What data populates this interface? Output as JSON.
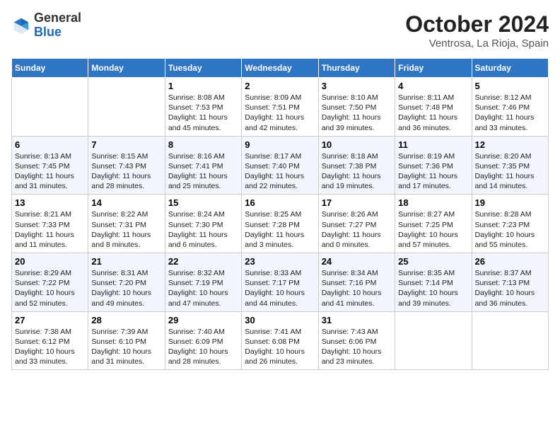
{
  "header": {
    "logo_general": "General",
    "logo_blue": "Blue",
    "month_title": "October 2024",
    "location": "Ventrosa, La Rioja, Spain"
  },
  "weekdays": [
    "Sunday",
    "Monday",
    "Tuesday",
    "Wednesday",
    "Thursday",
    "Friday",
    "Saturday"
  ],
  "weeks": [
    [
      {
        "day": "",
        "content": ""
      },
      {
        "day": "",
        "content": ""
      },
      {
        "day": "1",
        "content": "Sunrise: 8:08 AM\nSunset: 7:53 PM\nDaylight: 11 hours and 45 minutes."
      },
      {
        "day": "2",
        "content": "Sunrise: 8:09 AM\nSunset: 7:51 PM\nDaylight: 11 hours and 42 minutes."
      },
      {
        "day": "3",
        "content": "Sunrise: 8:10 AM\nSunset: 7:50 PM\nDaylight: 11 hours and 39 minutes."
      },
      {
        "day": "4",
        "content": "Sunrise: 8:11 AM\nSunset: 7:48 PM\nDaylight: 11 hours and 36 minutes."
      },
      {
        "day": "5",
        "content": "Sunrise: 8:12 AM\nSunset: 7:46 PM\nDaylight: 11 hours and 33 minutes."
      }
    ],
    [
      {
        "day": "6",
        "content": "Sunrise: 8:13 AM\nSunset: 7:45 PM\nDaylight: 11 hours and 31 minutes."
      },
      {
        "day": "7",
        "content": "Sunrise: 8:15 AM\nSunset: 7:43 PM\nDaylight: 11 hours and 28 minutes."
      },
      {
        "day": "8",
        "content": "Sunrise: 8:16 AM\nSunset: 7:41 PM\nDaylight: 11 hours and 25 minutes."
      },
      {
        "day": "9",
        "content": "Sunrise: 8:17 AM\nSunset: 7:40 PM\nDaylight: 11 hours and 22 minutes."
      },
      {
        "day": "10",
        "content": "Sunrise: 8:18 AM\nSunset: 7:38 PM\nDaylight: 11 hours and 19 minutes."
      },
      {
        "day": "11",
        "content": "Sunrise: 8:19 AM\nSunset: 7:36 PM\nDaylight: 11 hours and 17 minutes."
      },
      {
        "day": "12",
        "content": "Sunrise: 8:20 AM\nSunset: 7:35 PM\nDaylight: 11 hours and 14 minutes."
      }
    ],
    [
      {
        "day": "13",
        "content": "Sunrise: 8:21 AM\nSunset: 7:33 PM\nDaylight: 11 hours and 11 minutes."
      },
      {
        "day": "14",
        "content": "Sunrise: 8:22 AM\nSunset: 7:31 PM\nDaylight: 11 hours and 8 minutes."
      },
      {
        "day": "15",
        "content": "Sunrise: 8:24 AM\nSunset: 7:30 PM\nDaylight: 11 hours and 6 minutes."
      },
      {
        "day": "16",
        "content": "Sunrise: 8:25 AM\nSunset: 7:28 PM\nDaylight: 11 hours and 3 minutes."
      },
      {
        "day": "17",
        "content": "Sunrise: 8:26 AM\nSunset: 7:27 PM\nDaylight: 11 hours and 0 minutes."
      },
      {
        "day": "18",
        "content": "Sunrise: 8:27 AM\nSunset: 7:25 PM\nDaylight: 10 hours and 57 minutes."
      },
      {
        "day": "19",
        "content": "Sunrise: 8:28 AM\nSunset: 7:23 PM\nDaylight: 10 hours and 55 minutes."
      }
    ],
    [
      {
        "day": "20",
        "content": "Sunrise: 8:29 AM\nSunset: 7:22 PM\nDaylight: 10 hours and 52 minutes."
      },
      {
        "day": "21",
        "content": "Sunrise: 8:31 AM\nSunset: 7:20 PM\nDaylight: 10 hours and 49 minutes."
      },
      {
        "day": "22",
        "content": "Sunrise: 8:32 AM\nSunset: 7:19 PM\nDaylight: 10 hours and 47 minutes."
      },
      {
        "day": "23",
        "content": "Sunrise: 8:33 AM\nSunset: 7:17 PM\nDaylight: 10 hours and 44 minutes."
      },
      {
        "day": "24",
        "content": "Sunrise: 8:34 AM\nSunset: 7:16 PM\nDaylight: 10 hours and 41 minutes."
      },
      {
        "day": "25",
        "content": "Sunrise: 8:35 AM\nSunset: 7:14 PM\nDaylight: 10 hours and 39 minutes."
      },
      {
        "day": "26",
        "content": "Sunrise: 8:37 AM\nSunset: 7:13 PM\nDaylight: 10 hours and 36 minutes."
      }
    ],
    [
      {
        "day": "27",
        "content": "Sunrise: 7:38 AM\nSunset: 6:12 PM\nDaylight: 10 hours and 33 minutes."
      },
      {
        "day": "28",
        "content": "Sunrise: 7:39 AM\nSunset: 6:10 PM\nDaylight: 10 hours and 31 minutes."
      },
      {
        "day": "29",
        "content": "Sunrise: 7:40 AM\nSunset: 6:09 PM\nDaylight: 10 hours and 28 minutes."
      },
      {
        "day": "30",
        "content": "Sunrise: 7:41 AM\nSunset: 6:08 PM\nDaylight: 10 hours and 26 minutes."
      },
      {
        "day": "31",
        "content": "Sunrise: 7:43 AM\nSunset: 6:06 PM\nDaylight: 10 hours and 23 minutes."
      },
      {
        "day": "",
        "content": ""
      },
      {
        "day": "",
        "content": ""
      }
    ]
  ]
}
